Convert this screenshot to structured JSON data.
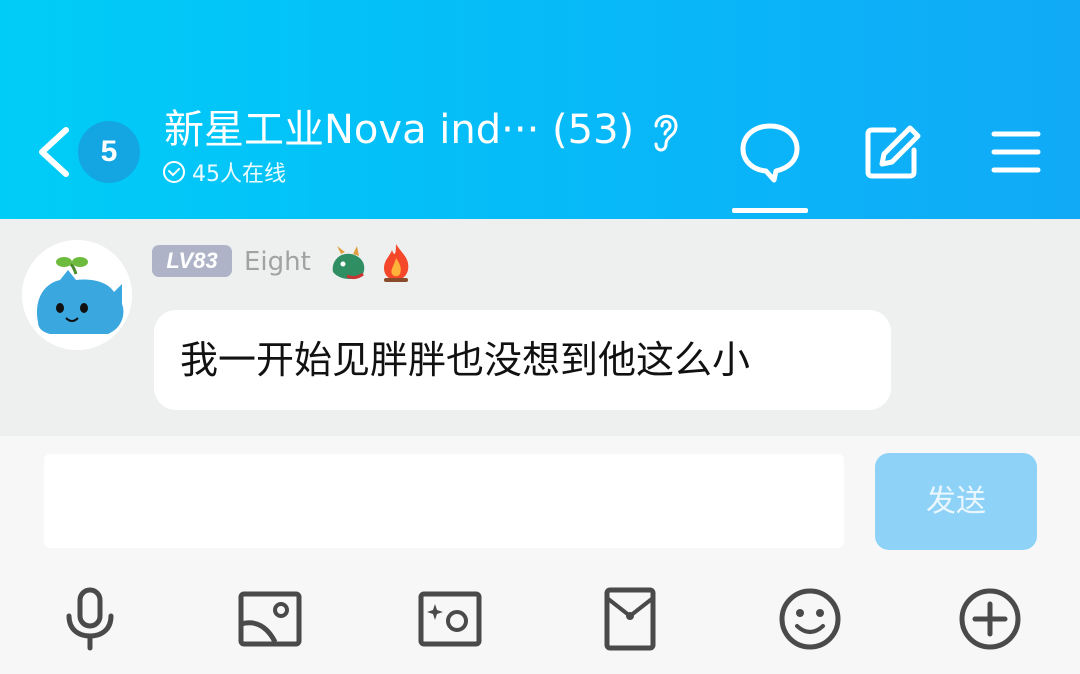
{
  "header": {
    "unread_count": "5",
    "group_title": "新星工业Nova ind···",
    "member_count": "(53)",
    "online_status": "45人在线",
    "icons": [
      "back-arrow-icon",
      "ear-icon",
      "chat-bubble-icon",
      "edit-icon",
      "menu-icon"
    ]
  },
  "messages": [
    {
      "level_badge": "LV83",
      "nickname": "Eight",
      "emoji_icons": [
        "dragon-icon",
        "fire-icon"
      ],
      "text": "我一开始见胖胖也没想到他这么小"
    }
  ],
  "composer": {
    "input_value": "",
    "send_label": "发送"
  },
  "toolbar": {
    "icons": [
      "microphone-icon",
      "image-icon",
      "camera-icon",
      "red-packet-icon",
      "emoji-icon",
      "plus-icon"
    ]
  },
  "colors": {
    "header_start": "#00cdf7",
    "header_end": "#11aaf7",
    "send_button": "#8ed2f7",
    "level_badge": "#aeb3c8",
    "icon_gray": "#4a4a4a"
  }
}
